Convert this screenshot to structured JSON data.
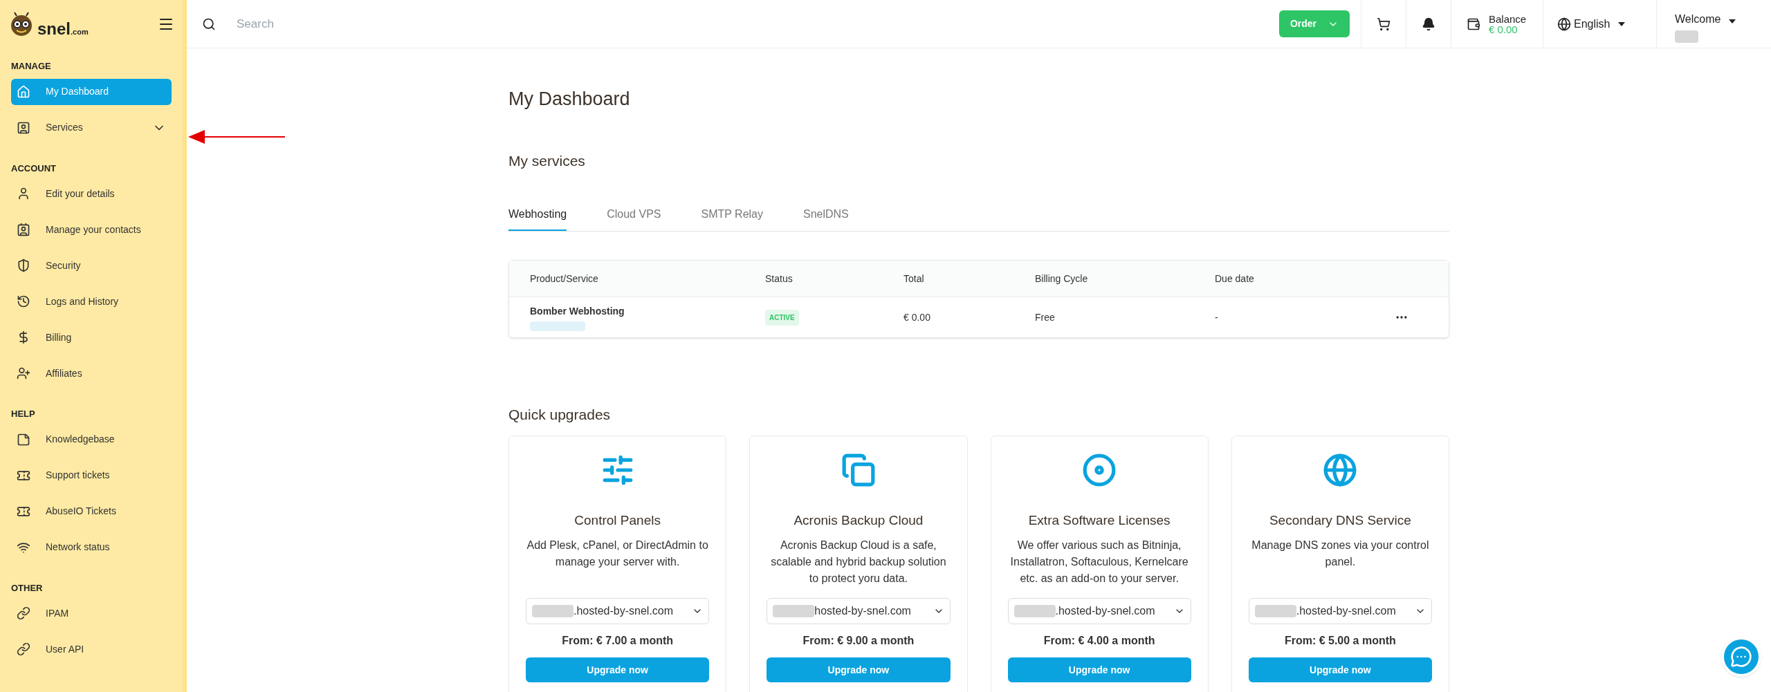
{
  "logo": {
    "name": "snel",
    "suffix": ".com"
  },
  "topbar": {
    "search": {
      "placeholder": "Search"
    },
    "order_button": "Order",
    "balance": {
      "label": "Balance",
      "amount": "€ 0.00"
    },
    "language": "English",
    "welcome": "Welcome"
  },
  "sidebar": {
    "sections": [
      {
        "heading": "MANAGE",
        "items": [
          {
            "kind": "link",
            "label": "My Dashboard",
            "selected": true
          },
          {
            "kind": "group",
            "label": "Services",
            "selected": false,
            "expanded": false
          }
        ]
      },
      {
        "heading": "ACCOUNT",
        "items": [
          {
            "kind": "link",
            "label": "Edit your details",
            "selected": false
          },
          {
            "kind": "link",
            "label": "Manage your contacts",
            "selected": false
          },
          {
            "kind": "link",
            "label": "Security",
            "selected": false
          },
          {
            "kind": "link",
            "label": "Logs and History",
            "selected": false
          },
          {
            "kind": "link",
            "label": "Billing",
            "selected": false
          },
          {
            "kind": "link",
            "label": "Affiliates",
            "selected": false
          }
        ]
      },
      {
        "heading": "HELP",
        "items": [
          {
            "kind": "link",
            "label": "Knowledgebase",
            "selected": false
          },
          {
            "kind": "link",
            "label": "Support tickets",
            "selected": false
          },
          {
            "kind": "link",
            "label": "AbuseIO Tickets",
            "selected": false
          },
          {
            "kind": "link",
            "label": "Network status",
            "selected": false
          }
        ]
      },
      {
        "heading": "OTHER",
        "items": [
          {
            "kind": "link",
            "label": "IPAM",
            "selected": false
          },
          {
            "kind": "link",
            "label": "User API",
            "selected": false
          }
        ]
      }
    ]
  },
  "page_title": "My Dashboard",
  "services": {
    "title": "My services",
    "tabs": [
      {
        "label": "Webhosting",
        "selected": true
      },
      {
        "label": "Cloud VPS",
        "selected": false
      },
      {
        "label": "SMTP Relay",
        "selected": false
      },
      {
        "label": "SnelDNS",
        "selected": false
      }
    ],
    "table": {
      "columns": [
        "Product/Service",
        "Status",
        "Total",
        "Billing Cycle",
        "Due date"
      ],
      "rows": [
        {
          "product": "Bomber Webhosting",
          "status": "ACTIVE",
          "total": "€ 0.00",
          "billing_cycle": "Free",
          "due_date": "-"
        }
      ]
    }
  },
  "quick_upgrades": {
    "title": "Quick upgrades",
    "cards": [
      {
        "title": "Control Panels",
        "description": "Add Plesk, cPanel, or DirectAdmin to manage your server with.",
        "domain": ".hosted-by-snel.com",
        "price": "From: € 7.00 a month",
        "button": "Upgrade now"
      },
      {
        "title": "Acronis Backup Cloud",
        "description": "Acronis Backup Cloud is a safe, scalable and hybrid backup solution to protect yoru data.",
        "domain": "hosted-by-snel.com",
        "price": "From: € 9.00 a month",
        "button": "Upgrade now"
      },
      {
        "title": "Extra Software Licenses",
        "description": "We offer various such as Bitninja, Installatron, Softaculous, Kernelcare etc. as an add-on to your server.",
        "domain": ".hosted-by-snel.com",
        "price": "From: € 4.00 a month",
        "button": "Upgrade now"
      },
      {
        "title": "Secondary DNS Service",
        "description": "Manage DNS zones via your control panel.",
        "domain": ".hosted-by-snel.com",
        "price": "From: € 5.00 a month",
        "button": "Upgrade now"
      }
    ]
  }
}
